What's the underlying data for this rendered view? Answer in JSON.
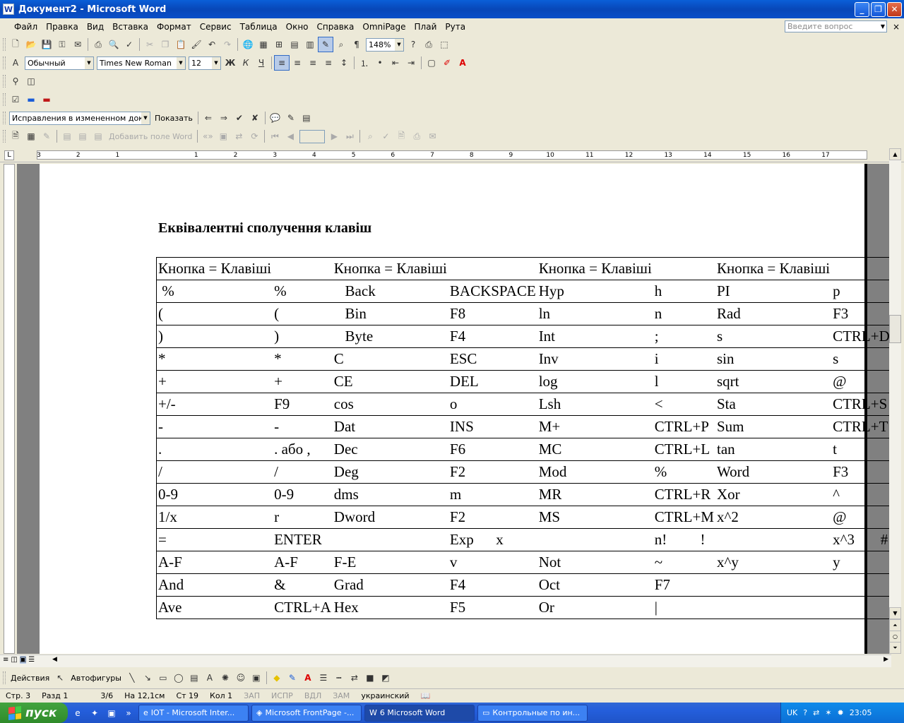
{
  "window": {
    "title": "Документ2 - Microsoft Word",
    "app_icon": "W",
    "buttons": [
      "_",
      "❐",
      "✕"
    ]
  },
  "menu": {
    "items": [
      "Файл",
      "Правка",
      "Вид",
      "Вставка",
      "Формат",
      "Сервис",
      "Таблица",
      "Окно",
      "Справка",
      "OmniPage",
      "Плай",
      "Рута"
    ],
    "ask_placeholder": "Введите вопрос",
    "close": "×"
  },
  "toolbar_standard": {
    "zoom": "148%"
  },
  "toolbar_format": {
    "style": "Обычный",
    "font": "Times New Roman",
    "size": "12",
    "bold": "Ж",
    "italic": "К",
    "underline": "Ч"
  },
  "toolbar_review": {
    "display": "Исправления в измененном документе",
    "show": "Показать"
  },
  "toolbar_mail": {
    "add_field": "Добавить поле Word"
  },
  "ruler": {
    "marks": [
      "3",
      "2",
      "1",
      "",
      "1",
      "2",
      "3",
      "4",
      "5",
      "6",
      "7",
      "8",
      "9",
      "10",
      "11",
      "12",
      "13",
      "14",
      "15",
      "16",
      "17"
    ],
    "corner": "L"
  },
  "document": {
    "heading": "Еквівалентні сполучення клавіш",
    "table": [
      [
        "Кнопка = Клавіші",
        "",
        "Кнопка = Клавіші",
        "",
        "Кнопка = Клавіші",
        "",
        "Кнопка = Клавіші",
        ""
      ],
      [
        " %",
        "%",
        "   Back",
        "BACKSPACE",
        "Hyp",
        "h",
        "PI",
        "p"
      ],
      [
        "(",
        "(",
        "   Bin",
        "F8",
        "ln",
        "n",
        "Rad",
        "F3"
      ],
      [
        ")",
        ")",
        "   Byte",
        "F4",
        "Int",
        ";",
        "s",
        "CTRL+D"
      ],
      [
        "*",
        "*",
        "C",
        "ESC",
        "Inv",
        "i",
        "sin",
        "s"
      ],
      [
        "+",
        "+",
        "CE",
        "DEL",
        "log",
        "l",
        "sqrt",
        "@"
      ],
      [
        "+/-",
        "F9",
        "cos",
        "o",
        "Lsh",
        "<",
        "Sta",
        "CTRL+S"
      ],
      [
        "-",
        "-",
        "Dat",
        "INS",
        "M+",
        "CTRL+P",
        "Sum",
        "CTRL+T"
      ],
      [
        ".",
        ". або ,",
        "Dec",
        "F6",
        "MC",
        "CTRL+L",
        "tan",
        "t"
      ],
      [
        "/",
        "/",
        "Deg",
        "F2",
        "Mod",
        "%",
        "Word",
        "F3"
      ],
      [
        "0-9",
        "0-9",
        "dms",
        "m",
        "MR",
        "CTRL+R",
        "Xor",
        "^"
      ],
      [
        "1/x",
        "r",
        "Dword",
        "F2",
        "MS",
        "CTRL+M",
        "x^2",
        "@"
      ],
      [
        "=",
        "ENTER",
        "",
        "Exp      x",
        "",
        "n!         !",
        "",
        "x^3       #"
      ],
      [
        "A-F",
        "A-F",
        "F-E",
        "v",
        "Not",
        "~",
        "x^y",
        "y"
      ],
      [
        "And",
        "&",
        "Grad",
        "F4",
        "Oct",
        "F7",
        "",
        ""
      ],
      [
        "Ave",
        "CTRL+A",
        "Hex",
        "F5",
        "Or",
        "|",
        "",
        ""
      ]
    ]
  },
  "drawing": {
    "actions": "Действия",
    "autoshapes": "Автофигуры"
  },
  "status": {
    "page": "Стр. 3",
    "section": "Разд 1",
    "pages": "3/6",
    "at": "На 12,1см",
    "line": "Ст 19",
    "col": "Кол 1",
    "rec": "ЗАП",
    "trk": "ИСПР",
    "ext": "ВДЛ",
    "ovr": "ЗАМ",
    "lang": "украинский"
  },
  "taskbar": {
    "start": "пуск",
    "tasks": [
      "IOT - Microsoft Inter...",
      "Microsoft FrontPage -...",
      "6 Microsoft Word",
      "Контрольные по ин..."
    ],
    "lang": "UK",
    "time": "23:05"
  }
}
